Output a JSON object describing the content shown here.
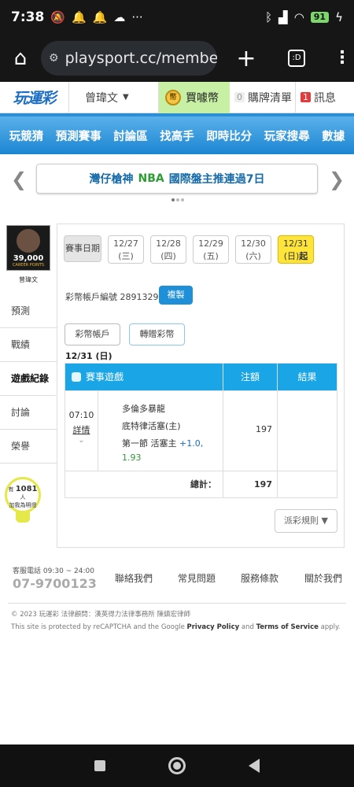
{
  "status": {
    "time": "7:38",
    "battery": "91",
    "icons": [
      "mute-icon",
      "bell-icon",
      "bell-icon",
      "cloud-icon",
      "more-icon"
    ]
  },
  "browser": {
    "url": "playsport.cc/member/",
    "tabs_label": ":D"
  },
  "topnav": {
    "logo": "玩運彩",
    "user": "曾瑋文",
    "buy_coin": "買噱幣",
    "cart_count": "0",
    "cart": "購牌清單",
    "msg_count": "1",
    "msg": "訊息"
  },
  "mainnav": [
    "玩競猜",
    "預測賽事",
    "討論區",
    "找高手",
    "即時比分",
    "玩家搜尋",
    "數據"
  ],
  "banner": {
    "pre": "灣仔槍神",
    "nba": "NBA",
    "post": "國際盤主推連過7日"
  },
  "sidebar": {
    "avatar_text": "39,000",
    "avatar_sub": "CAREER POINTS",
    "username": "曾瑋文",
    "items": [
      "預測",
      "戰績",
      "遊戲紀錄",
      "討論",
      "榮譽"
    ],
    "bulb_pre": "有",
    "bulb_count": "1081",
    "bulb_unit": "人",
    "bulb_post": "加我為明燈"
  },
  "panel": {
    "date_label": "賽事日期",
    "dates": [
      {
        "d": "12/27",
        "w": "(三)"
      },
      {
        "d": "12/28",
        "w": "(四)"
      },
      {
        "d": "12/29",
        "w": "(五)"
      },
      {
        "d": "12/30",
        "w": "(六)"
      },
      {
        "d": "12/31",
        "w": "(日)",
        "extra": "起"
      }
    ],
    "account": "彩幣帳戶編號 28913297",
    "copy": "複製",
    "tab1": "彩幣帳戶",
    "tab2": "轉贈彩幣",
    "day": "12/31 (日)",
    "headers": [
      "賽事遊戲",
      "注額",
      "結果"
    ],
    "row": {
      "time": "07:10",
      "detail": "詳情",
      "team1": "多倫多暴龍",
      "team2": "底特律活塞(主)",
      "bet": "第一節 活塞主",
      "line": "+1.0,",
      "odds": "1.93",
      "amount": "197",
      "result": ""
    },
    "total_label": "總計：",
    "total": "197",
    "rule": "派彩規則 ▼"
  },
  "footer": {
    "service": "客服電話 09:30 ~ 24:00",
    "phone": "07-9700123",
    "links": [
      "聯絡我們",
      "常見問題",
      "服務條款",
      "關於我們"
    ],
    "copyright": "© 2023 玩運彩 法律顧問：漢英得力法律事務所 陳鎮宏律師",
    "recaptcha_pre": "This site is protected by reCAPTCHA and the Google ",
    "privacy": "Privacy Policy",
    "and": " and ",
    "terms": "Terms of Service",
    "apply": " apply."
  },
  "colors": {
    "accent": "#1aa5e6",
    "selected_date": "#ffe43a",
    "nav": "#1c86d2",
    "buy_coin_bg": "#c8f0a5",
    "odds_green": "#2e9c33",
    "line_blue": "#1a6dc2"
  }
}
